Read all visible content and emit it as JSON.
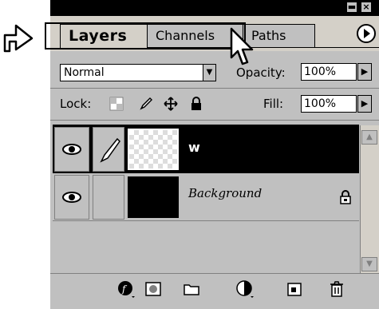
{
  "tabs": [
    {
      "label": "Layers",
      "active": true
    },
    {
      "label": "Channels",
      "active": false
    },
    {
      "label": "Paths",
      "active": false
    }
  ],
  "window_buttons": {
    "minimize": "▬",
    "close": "×"
  },
  "blend_mode": {
    "value": "Normal"
  },
  "opacity": {
    "label": "Opacity:",
    "value": "100%"
  },
  "lock": {
    "label": "Lock:",
    "icons": [
      "lock-transparency-icon",
      "lock-paint-icon",
      "lock-position-icon",
      "lock-all-icon"
    ]
  },
  "fill": {
    "label": "Fill:",
    "value": "100%"
  },
  "layers": [
    {
      "name": "w",
      "visible": true,
      "selected": true,
      "editable_icon": "brush-icon",
      "thumbnail": "transparent"
    },
    {
      "name": "Background",
      "visible": true,
      "selected": false,
      "locked": true,
      "thumbnail": "black"
    }
  ],
  "bottom_toolbar": [
    "layer-style-icon",
    "add-mask-icon",
    "new-set-icon",
    "adjustment-layer-icon",
    "new-layer-icon",
    "trash-icon"
  ],
  "colors": {
    "selected_row": "#000000",
    "panel": "#c0c0c0",
    "tab_active": "#d4d0c8"
  }
}
